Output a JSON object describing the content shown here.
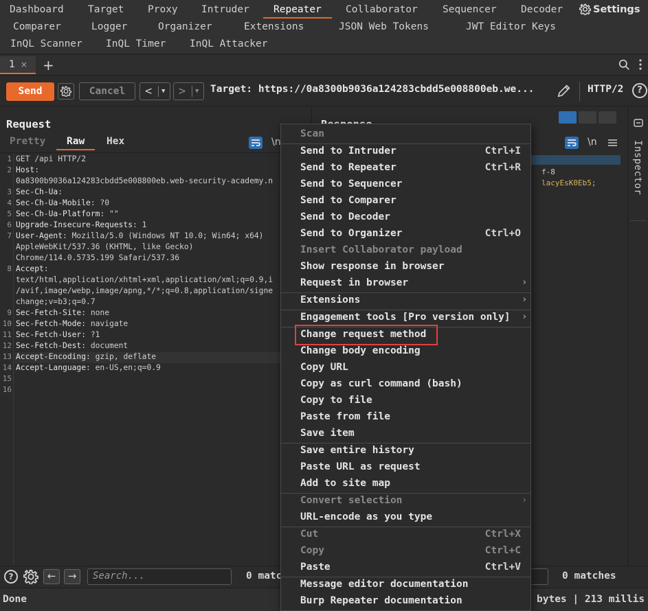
{
  "nav": {
    "row1": [
      "Dashboard",
      "Target",
      "Proxy",
      "Intruder",
      "Repeater",
      "Collaborator",
      "Sequencer",
      "Decoder"
    ],
    "row2": [
      "Comparer",
      "Logger",
      "Organizer",
      "Extensions",
      "JSON Web Tokens",
      "JWT Editor Keys"
    ],
    "row3": [
      "InQL Scanner",
      "InQL Timer",
      "InQL Attacker"
    ],
    "active": "Repeater",
    "settings_label": "Settings"
  },
  "tabs": {
    "current": "1",
    "close": "×",
    "add": "+"
  },
  "toolbar": {
    "send_label": "Send",
    "cancel_label": "Cancel",
    "back": "<",
    "forward": ">",
    "target_text": "Target: https://0a8300b9036a124283cbdd5e008800eb.we...",
    "http_version": "HTTP/2",
    "help": "?"
  },
  "request": {
    "title": "Request",
    "tabs": [
      "Pretty",
      "Raw",
      "Hex"
    ],
    "active_tab": "Raw",
    "newline_toggle": "\\n",
    "lines": [
      {
        "n": "1",
        "k": "",
        "v": "GET /api HTTP/2"
      },
      {
        "n": "2",
        "k": "Host",
        "v": ":"
      },
      {
        "n": "",
        "k": "",
        "v": "0a8300b9036a124283cbdd5e008800eb.web-security-academy.n"
      },
      {
        "n": "3",
        "k": "Sec-Ch-Ua",
        "v": ":"
      },
      {
        "n": "4",
        "k": "Sec-Ch-Ua-Mobile",
        "v": ": ?0"
      },
      {
        "n": "5",
        "k": "Sec-Ch-Ua-Platform",
        "v": ": \"\""
      },
      {
        "n": "6",
        "k": "Upgrade-Insecure-Requests",
        "v": ": 1"
      },
      {
        "n": "7",
        "k": "User-Agent",
        "v": ": Mozilla/5.0 (Windows NT 10.0; Win64; x64)"
      },
      {
        "n": "",
        "k": "",
        "v": "AppleWebKit/537.36 (KHTML, like Gecko)"
      },
      {
        "n": "",
        "k": "",
        "v": "Chrome/114.0.5735.199 Safari/537.36"
      },
      {
        "n": "8",
        "k": "Accept",
        "v": ":"
      },
      {
        "n": "",
        "k": "",
        "v": "text/html,application/xhtml+xml,application/xml;q=0.9,i"
      },
      {
        "n": "",
        "k": "",
        "v": "/avif,image/webp,image/apng,*/*;q=0.8,application/signe"
      },
      {
        "n": "",
        "k": "",
        "v": "change;v=b3;q=0.7"
      },
      {
        "n": "9",
        "k": "Sec-Fetch-Site",
        "v": ": none"
      },
      {
        "n": "10",
        "k": "Sec-Fetch-Mode",
        "v": ": navigate"
      },
      {
        "n": "11",
        "k": "Sec-Fetch-User",
        "v": ": ?1"
      },
      {
        "n": "12",
        "k": "Sec-Fetch-Dest",
        "v": ": document"
      },
      {
        "n": "13",
        "k": "Accept-Encoding",
        "v": ": gzip, deflate"
      },
      {
        "n": "14",
        "k": "Accept-Language",
        "v": ": en-US,en;q=0.9"
      },
      {
        "n": "15",
        "k": "",
        "v": ""
      },
      {
        "n": "16",
        "k": "",
        "v": ""
      }
    ]
  },
  "response": {
    "title": "Response",
    "newline_toggle": "\\n",
    "visible_fragments": [
      "f-8",
      "lacyEsK0Eb5;"
    ]
  },
  "inspector": {
    "label": "Inspector"
  },
  "search": {
    "placeholder": "Search...",
    "left_matches": "0 matc",
    "right_matches": "0 matches"
  },
  "status": {
    "left": "Done",
    "right": "bytes | 213 millis"
  },
  "context_menu": {
    "items": [
      {
        "label": "Scan",
        "disabled": true
      },
      {
        "sep": true
      },
      {
        "label": "Send to Intruder",
        "shortcut": "Ctrl+I"
      },
      {
        "label": "Send to Repeater",
        "shortcut": "Ctrl+R"
      },
      {
        "label": "Send to Sequencer"
      },
      {
        "label": "Send to Comparer"
      },
      {
        "label": "Send to Decoder"
      },
      {
        "label": "Send to Organizer",
        "shortcut": "Ctrl+O"
      },
      {
        "label": "Insert Collaborator payload",
        "disabled": true
      },
      {
        "label": "Show response in browser"
      },
      {
        "label": "Request in browser",
        "submenu": true
      },
      {
        "sep": true
      },
      {
        "label": "Extensions",
        "submenu": true
      },
      {
        "sep": true
      },
      {
        "label": "Engagement tools [Pro version only]",
        "submenu": true
      },
      {
        "sep": true
      },
      {
        "label": "Change request method",
        "highlighted": true
      },
      {
        "label": "Change body encoding"
      },
      {
        "label": "Copy URL"
      },
      {
        "label": "Copy as curl command (bash)"
      },
      {
        "label": "Copy to file"
      },
      {
        "label": "Paste from file"
      },
      {
        "label": "Save item"
      },
      {
        "sep": true
      },
      {
        "label": "Save entire history"
      },
      {
        "label": "Paste URL as request"
      },
      {
        "label": "Add to site map"
      },
      {
        "sep": true
      },
      {
        "label": "Convert selection",
        "disabled": true,
        "submenu": true
      },
      {
        "label": "URL-encode as you type"
      },
      {
        "sep": true
      },
      {
        "label": "Cut",
        "shortcut": "Ctrl+X",
        "disabled": true
      },
      {
        "label": "Copy",
        "shortcut": "Ctrl+C",
        "disabled": true
      },
      {
        "label": "Paste",
        "shortcut": "Ctrl+V"
      },
      {
        "sep": true
      },
      {
        "label": "Message editor documentation"
      },
      {
        "label": "Burp Repeater documentation"
      }
    ],
    "submenu_glyph": "›"
  },
  "colors": {
    "accent": "#e8692c",
    "highlight_box": "#e0413f",
    "toggle_blue": "#2f6fb3"
  }
}
